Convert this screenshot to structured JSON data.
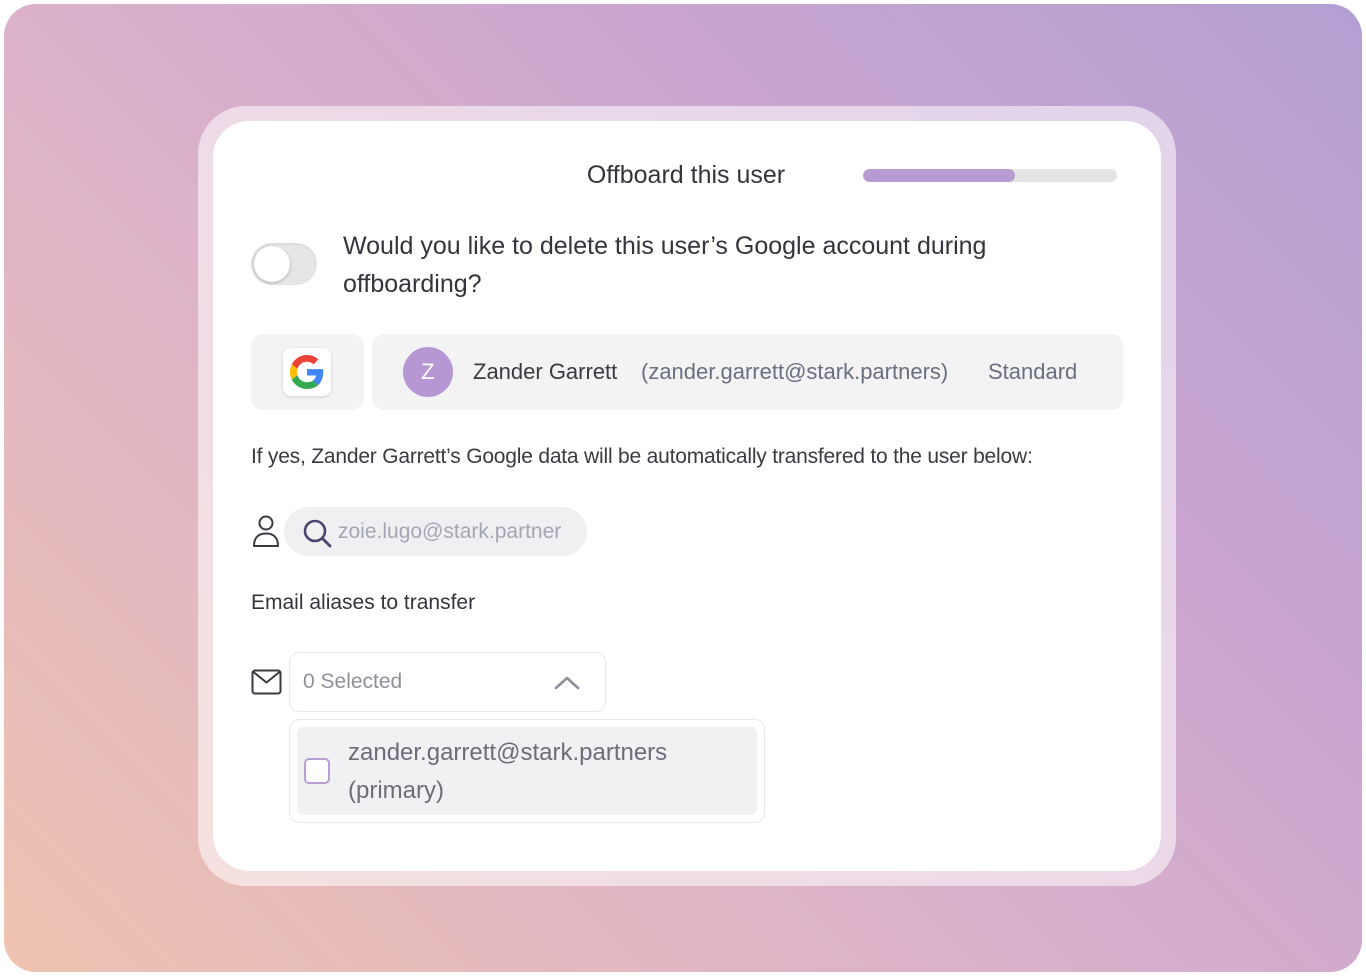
{
  "dialog": {
    "title": "Offboard this user",
    "progress_fraction": 0.6
  },
  "delete_account": {
    "question": "Would you like to delete this user’s Google account during offboarding?",
    "toggle_on": false
  },
  "user": {
    "provider_icon": "google-logo",
    "avatar_initial": "Z",
    "name": "Zander Garrett",
    "email": "(zander.garrett@stark.partners)",
    "role": "Standard"
  },
  "transfer": {
    "info_text": "If yes, Zander Garrett’s Google data will be automatically transfered to the user below:",
    "recipient_icon": "person-icon",
    "search_icon": "search-icon",
    "search_value": "zoie.lugo@stark.partner"
  },
  "aliases": {
    "label": "Email aliases to transfer",
    "field_icon": "mail-icon",
    "selected_text": "0 Selected",
    "options": [
      {
        "label": "zander.garrett@stark.partners (primary)",
        "checked": false
      }
    ]
  },
  "colors": {
    "accent": "#b79bd2",
    "avatar": "#b797d3",
    "muted_text": "#6a6f80"
  }
}
